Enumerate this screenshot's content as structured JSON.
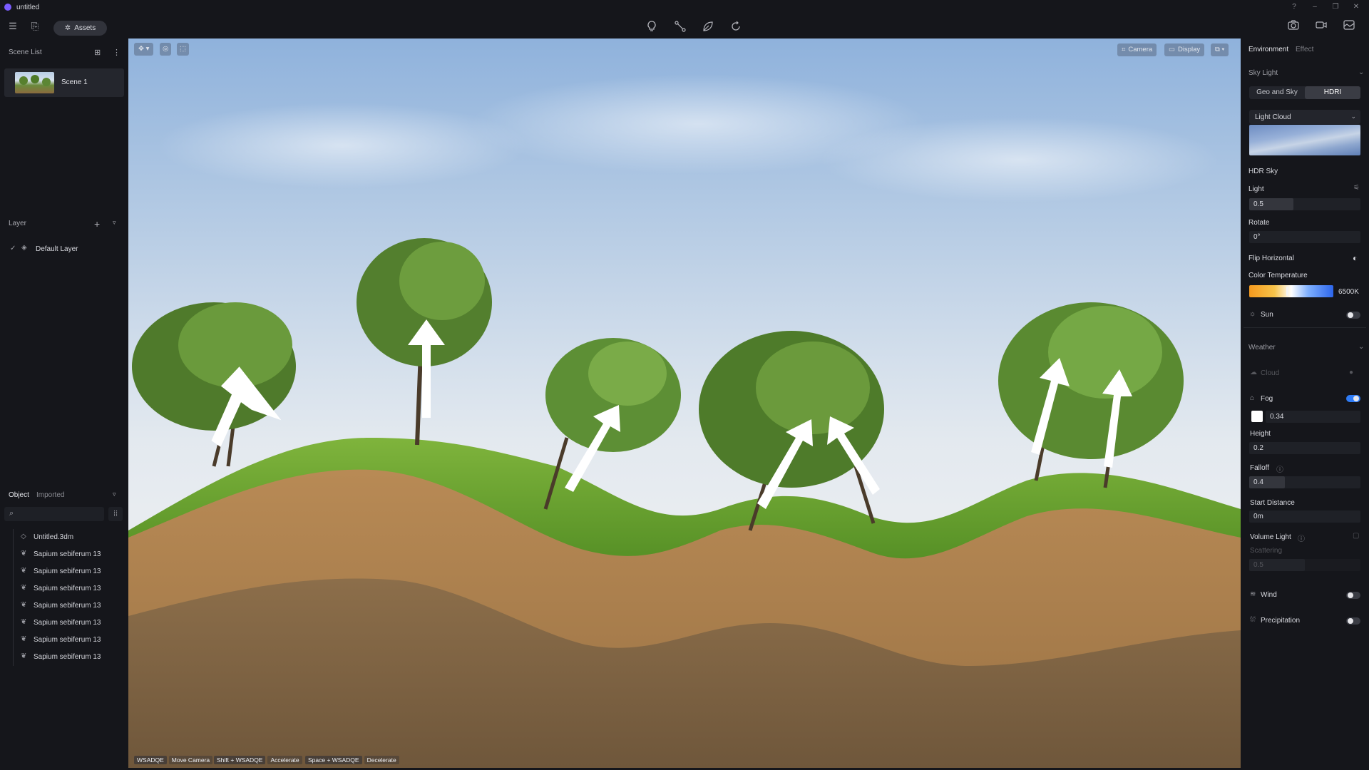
{
  "app": {
    "title": "untitled"
  },
  "toolbar": {
    "assets_label": "Assets"
  },
  "scene_list": {
    "header": "Scene List",
    "scenes": [
      {
        "name": "Scene 1"
      }
    ]
  },
  "layers": {
    "header": "Layer",
    "items": [
      {
        "name": "Default Layer"
      }
    ]
  },
  "objects": {
    "tabs": [
      "Object",
      "Imported"
    ],
    "items": [
      {
        "name": "Untitled.3dm"
      },
      {
        "name": "Sapium sebiferum 13"
      },
      {
        "name": "Sapium sebiferum 13"
      },
      {
        "name": "Sapium sebiferum 13"
      },
      {
        "name": "Sapium sebiferum 13"
      },
      {
        "name": "Sapium sebiferum 13"
      },
      {
        "name": "Sapium sebiferum 13"
      },
      {
        "name": "Sapium sebiferum 13"
      }
    ]
  },
  "viewport": {
    "camera_label": "Camera",
    "display_label": "Display",
    "hints": [
      {
        "key": "WSADQE",
        "action": "Move Camera"
      },
      {
        "key": "Shift + WSADQE",
        "action": "Accelerate"
      },
      {
        "key": "Space + WSADQE",
        "action": "Decelerate"
      }
    ]
  },
  "environment": {
    "tabs": [
      "Environment",
      "Effect"
    ],
    "sky_light_header": "Sky Light",
    "sky_modes": [
      "Geo and Sky",
      "HDRI"
    ],
    "sky_preset": "Light Cloud",
    "hdr_sky_label": "HDR Sky",
    "light_label": "Light",
    "light_value": "0.5",
    "light_fraction": 0.5,
    "rotate_label": "Rotate",
    "rotate_value": "0°",
    "flip_label": "Flip Horizontal",
    "color_temp_label": "Color Temperature",
    "color_temp_value": "6500K",
    "sun_label": "Sun",
    "sun_enabled": false
  },
  "weather": {
    "header": "Weather",
    "cloud_label": "Cloud",
    "fog_label": "Fog",
    "fog_enabled": true,
    "fog_color": "#ffffff",
    "fog_density": "0.34",
    "height_label": "Height",
    "height_value": "0.2",
    "falloff_label": "Falloff",
    "falloff_value": "0.4",
    "falloff_fraction": 0.4,
    "start_distance_label": "Start Distance",
    "start_distance_value": "0m",
    "volume_light_label": "Volume Light",
    "scattering_label": "Scattering",
    "scattering_value": "0.5",
    "wind_label": "Wind",
    "wind_enabled": false,
    "precipitation_label": "Precipitation",
    "precipitation_enabled": false
  },
  "colors": {
    "accent": "#2f7cf6",
    "panel_bg": "#15161b",
    "field_bg": "#1f2127"
  }
}
